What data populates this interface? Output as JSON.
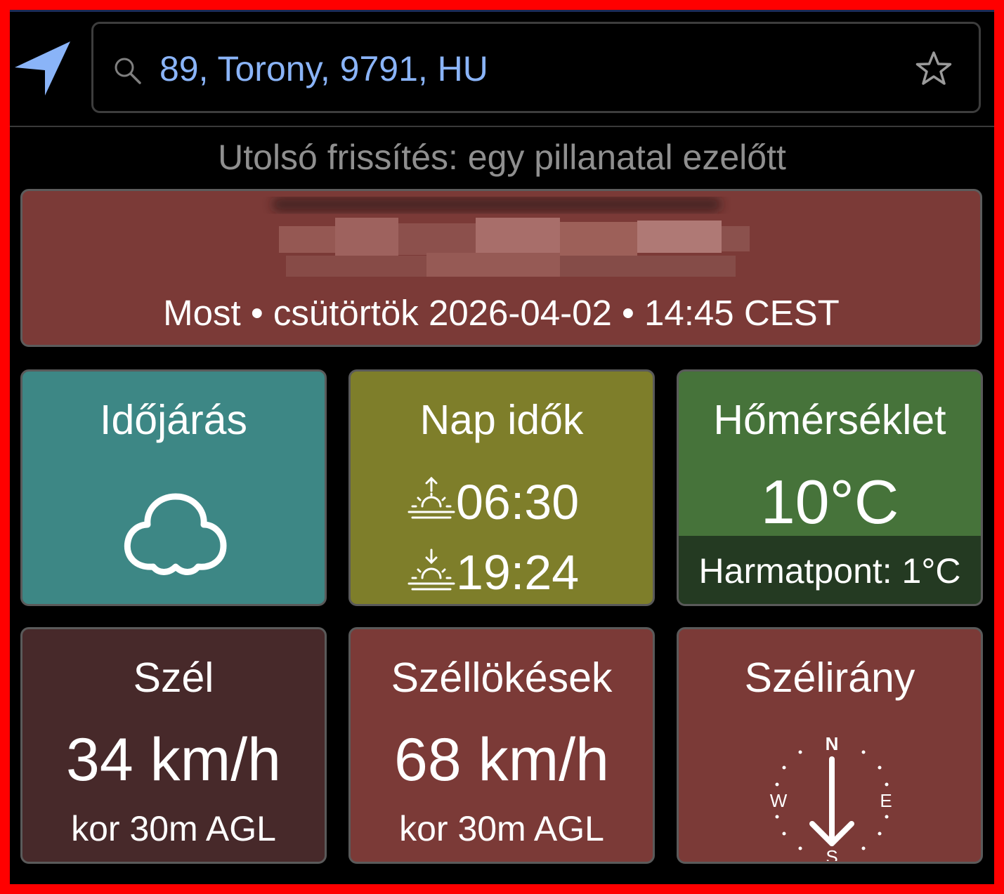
{
  "search": {
    "value": "89, Torony, 9791, HU"
  },
  "icons": {
    "location": "navigation-arrow-icon",
    "search": "search-icon",
    "favorite": "star-outline-icon",
    "weather": "cloud-icon",
    "sunrise": "sunrise-icon",
    "sunset": "sunset-icon",
    "wind_direction": "compass-icon"
  },
  "status": {
    "last_updated": "Utolsó frissítés: egy pillanatal ezelőtt"
  },
  "now_card": {
    "line": "Most • csütörtök 2026-04-02 • 14:45 CEST"
  },
  "tiles": {
    "weather": {
      "title": "Időjárás"
    },
    "sun_times": {
      "title": "Nap idők",
      "sunrise": "06:30",
      "sunset": "19:24"
    },
    "temperature": {
      "title": "Hőmérséklet",
      "value": "10°C",
      "dew_point": "Harmatpont: 1°C"
    },
    "wind": {
      "title": "Szél",
      "value": "34 km/h",
      "note": "kor 30m AGL"
    },
    "gusts": {
      "title": "Széllökések",
      "value": "68 km/h",
      "note": "kor 30m AGL"
    },
    "wind_direction": {
      "title": "Szélirány",
      "labels": {
        "n": "N",
        "e": "E",
        "s": "S",
        "w": "W"
      },
      "arrow_points_to": "S"
    }
  },
  "colors": {
    "accent_blue": "#8ab4f8",
    "banner": "#7b3a37",
    "weather_tile": "#3d8785",
    "sun_tile": "#7e7e2a",
    "temp_tile": "#46733a",
    "temp_tile_footer": "#243a22",
    "wind_tile": "#47292a",
    "gust_tile": "#7b3a37",
    "direction_tile": "#7b3a37"
  }
}
